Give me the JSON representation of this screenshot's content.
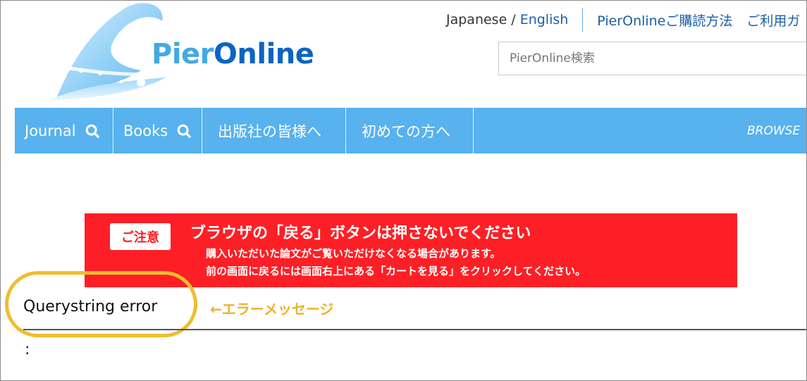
{
  "logo": {
    "part1": "Pier",
    "part2": "Online"
  },
  "topnav": {
    "lang_ja": "Japanese",
    "lang_sep": "/",
    "lang_en": "English",
    "link_subscribe": "PierOnlineご購読方法",
    "link_usage": "ご利用ガ"
  },
  "search": {
    "placeholder": "PierOnline検索"
  },
  "mainnav": {
    "items": [
      {
        "label": "Journal"
      },
      {
        "label": "Books"
      },
      {
        "label": "出版社の皆様へ"
      },
      {
        "label": "初めての方へ"
      }
    ],
    "browse": "BROWSE"
  },
  "notice": {
    "badge": "ご注意",
    "headline": "ブラウザの「戻る」ボタンは押さないでください",
    "line1": "購入いただいた論文がご覧いただけなくなる場合があります。",
    "line2": "前の画面に戻るには画面右上にある「カートを見る」をクリックしてください。"
  },
  "error": {
    "message": "Querystring error",
    "annotation": "←エラーメッセージ",
    "trailing": ":"
  },
  "colors": {
    "nav_bg": "#57b2ee",
    "notice_bg": "#fe1f26",
    "highlight": "#f0bd2e",
    "link": "#1a5fa8"
  }
}
